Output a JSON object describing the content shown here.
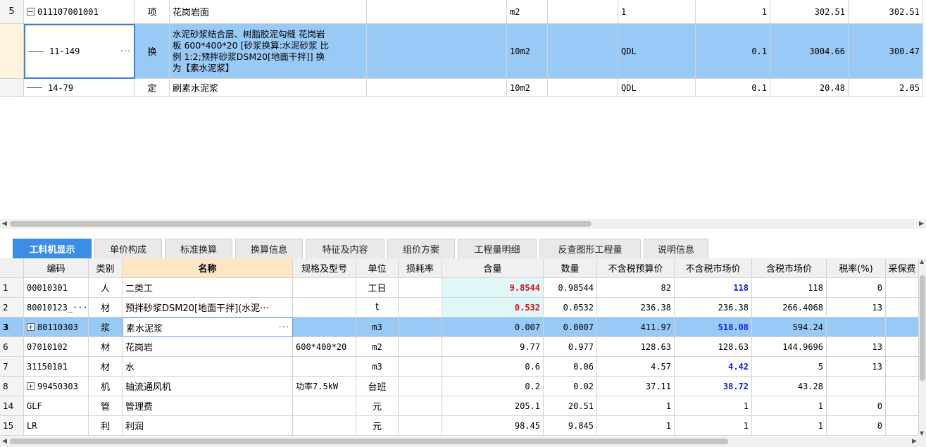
{
  "top_grid": {
    "rows": [
      {
        "num": "5",
        "code": "011107001001",
        "type": "项",
        "name": "花岗岩面",
        "unit": "m2",
        "expr": "1",
        "qty": "1",
        "price": "302.51",
        "total": "302.51",
        "expanded": true
      },
      {
        "num": "",
        "code": "11-149",
        "type": "换",
        "name_lines": [
          "水泥砂浆结合层、树脂胶泥勾缝 花岗岩",
          "板 600*400*20 [砂浆换算:水泥砂浆 比",
          "例 1:2;预拌砂浆DSM20[地面干拌]] 换",
          "为【素水泥浆】"
        ],
        "unit": "10m2",
        "expr": "QDL",
        "qty": "0.1",
        "price": "3004.66",
        "total": "300.47",
        "ellipsis": "···"
      },
      {
        "num": "",
        "code": "14-79",
        "type": "定",
        "name": "刷素水泥浆",
        "unit": "10m2",
        "expr": "QDL",
        "qty": "0.1",
        "price": "20.48",
        "total": "2.05"
      }
    ]
  },
  "tabs": [
    "工料机显示",
    "单价构成",
    "标准换算",
    "换算信息",
    "特征及内容",
    "组价方案",
    "工程量明细",
    "反查图形工程量",
    "说明信息"
  ],
  "active_tab": "工料机显示",
  "bottom_grid": {
    "headers": [
      "编码",
      "类别",
      "名称",
      "规格及型号",
      "单位",
      "损耗率",
      "含量",
      "数量",
      "不含税预算价",
      "不含税市场价",
      "含税市场价",
      "税率(%)",
      "采保费"
    ],
    "rows": [
      {
        "rn": "1",
        "code": "00010301",
        "cat": "人",
        "name": "二类工",
        "spec": "",
        "unit": "工日",
        "loss": "",
        "content": "9.8544",
        "qty": "0.98544",
        "budget": "82",
        "market": "118",
        "taxmarket": "118",
        "tax": "0"
      },
      {
        "rn": "2",
        "code": "80010123_···",
        "cat": "材",
        "name": "预拌砂浆DSM20[地面干拌](水泥···",
        "spec": "",
        "unit": "t",
        "loss": "",
        "content": "0.532",
        "qty": "0.0532",
        "budget": "236.38",
        "market": "236.38",
        "taxmarket": "266.4068",
        "tax": "13"
      },
      {
        "rn": "3",
        "code": "80110303",
        "cat": "浆",
        "name": "素水泥浆",
        "spec": "",
        "unit": "m3",
        "loss": "",
        "content": "0.007",
        "qty": "0.0007",
        "budget": "411.97",
        "market": "518.08",
        "taxmarket": "594.24",
        "tax": "",
        "expand": true,
        "ellipsis": "···"
      },
      {
        "rn": "6",
        "code": "07010102",
        "cat": "材",
        "name": "花岗岩",
        "spec": "600*400*20",
        "unit": "m2",
        "loss": "",
        "content": "9.77",
        "qty": "0.977",
        "budget": "128.63",
        "market": "128.63",
        "taxmarket": "144.9696",
        "tax": "13"
      },
      {
        "rn": "7",
        "code": "31150101",
        "cat": "材",
        "name": "水",
        "spec": "",
        "unit": "m3",
        "loss": "",
        "content": "0.6",
        "qty": "0.06",
        "budget": "4.57",
        "market": "4.42",
        "taxmarket": "5",
        "tax": "13"
      },
      {
        "rn": "8",
        "code": "99450303",
        "cat": "机",
        "name": "轴流通风机",
        "spec": "功率7.5kW",
        "unit": "台班",
        "loss": "",
        "content": "0.2",
        "qty": "0.02",
        "budget": "37.11",
        "market": "38.72",
        "taxmarket": "43.28",
        "tax": "",
        "expand": true
      },
      {
        "rn": "14",
        "code": "GLF",
        "cat": "管",
        "name": "管理费",
        "spec": "",
        "unit": "元",
        "loss": "",
        "content": "205.1",
        "qty": "20.51",
        "budget": "1",
        "market": "1",
        "taxmarket": "1",
        "tax": "0"
      },
      {
        "rn": "15",
        "code": "LR",
        "cat": "利",
        "name": "利润",
        "spec": "",
        "unit": "元",
        "loss": "",
        "content": "98.45",
        "qty": "9.845",
        "budget": "1",
        "market": "1",
        "taxmarket": "1",
        "tax": "0"
      }
    ]
  },
  "colors": {
    "selected": "#99c9f5",
    "tab_active": "#3a8ee6",
    "name_header": "#fce6c4",
    "content_bg": "#dff7f7",
    "red": "#e01010",
    "blue": "#1020e0"
  }
}
